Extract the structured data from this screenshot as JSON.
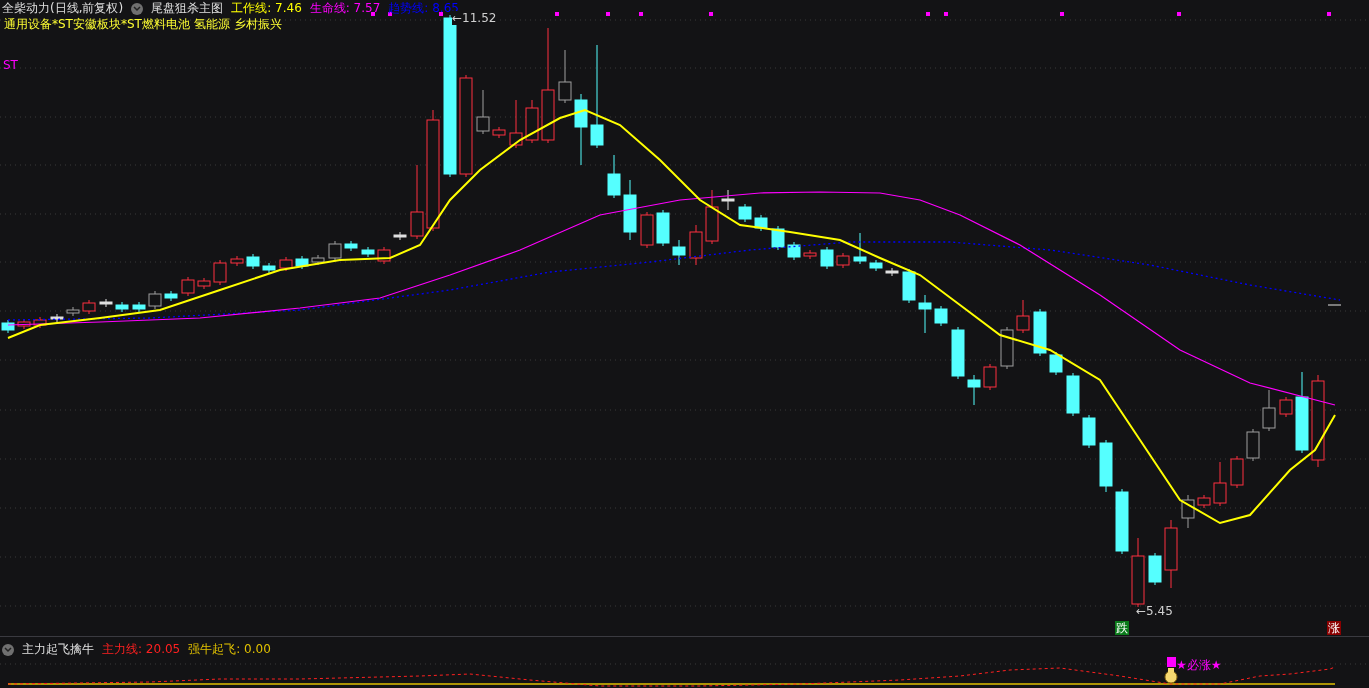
{
  "main_chart": {
    "title": "全柴动力(日线,前复权)",
    "indicator": "尾盘狙杀主图",
    "legend": [
      {
        "label": "工作线: 7.46",
        "color": "#ffff00"
      },
      {
        "label": "生命线: 7.57",
        "color": "#ff00ff"
      },
      {
        "label": "趋势线: 8.65",
        "color": "#0000ff"
      }
    ],
    "sectors": "通用设备*ST安徽板块*ST燃料电池 氢能源 乡村振兴",
    "st_label": "ST",
    "high_label": "←11.52",
    "low_label": "←5.45",
    "signals": [
      {
        "text": "跌",
        "kind": "down"
      },
      {
        "text": "涨",
        "kind": "up"
      }
    ]
  },
  "sub_chart": {
    "title": "主力起飞擒牛",
    "legend": [
      {
        "label": "主力线: 20.05",
        "color": "#ff2020"
      },
      {
        "label": "强牛起飞: 0.00",
        "color": "#e0c000"
      }
    ],
    "signal": "★必涨★"
  }
}
